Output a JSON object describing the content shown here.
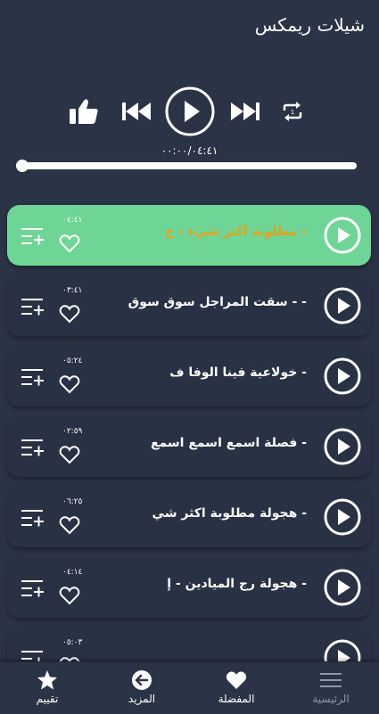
{
  "header": {
    "title": "شيلات ريمكس"
  },
  "player": {
    "time": "٠٠:٠٠/٠٤:٤١",
    "progress": 0
  },
  "tracks": [
    {
      "title": "- مطلوبة أكثر شيء - ح",
      "duration": "٠٤:٤١",
      "active": true
    },
    {
      "title": "- - سقت المراجل سوق سوق",
      "duration": "٠٣:٤١",
      "active": false
    },
    {
      "title": "- خولاعية   فينا الوفا ف",
      "duration": "٠٥:٢٤",
      "active": false
    },
    {
      "title": "- فصلة اسمع اسمع اسمع",
      "duration": "٠٢:٥٩",
      "active": false
    },
    {
      "title": "- هجولة   مطلوبة اكثر شي",
      "duration": "٠٦:٢٥",
      "active": false
    },
    {
      "title": "- هجولة  رج الميادين - إ",
      "duration": "٠٤:١٤",
      "active": false
    },
    {
      "title": "",
      "duration": "٠٥:٠٣",
      "active": false
    }
  ],
  "nav": {
    "rate": "تقييم",
    "more": "المزيد",
    "favorites": "المفضلة",
    "home": "الرئيسية"
  },
  "colors": {
    "background": "#2b3447",
    "active_row": "#6fd596",
    "active_title": "#e8a21a"
  }
}
